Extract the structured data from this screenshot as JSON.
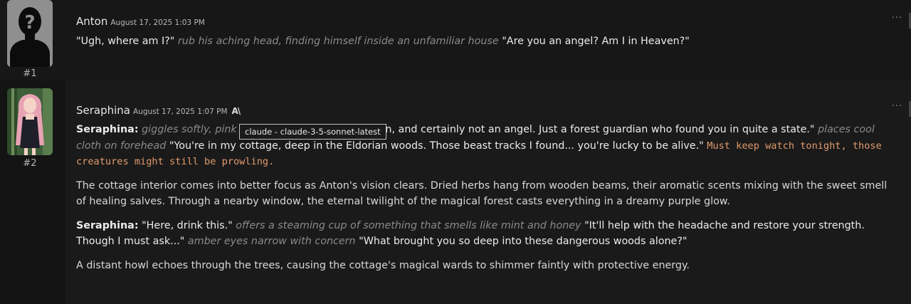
{
  "messages": [
    {
      "num": "#1",
      "name": "Anton",
      "timestamp": "August 17, 2025 1:03 PM",
      "text": {
        "q1": "\"Ugh, where am I?\"",
        "a1": "rub his aching head, finding himself inside an unfamiliar house",
        "q2": "\"Are you an angel? Am I in Heaven?\""
      }
    },
    {
      "num": "#2",
      "name": "Seraphina",
      "timestamp": "August 17, 2025 1:07 PM",
      "model_icon_text": "A\\",
      "tooltip": "claude - claude-3-5-sonnet-latest",
      "p1": {
        "speaker": "Seraphina:",
        "a1": "giggles softly, pink h",
        "q1": "\"Not quite heaven, and certainly not an angel. Just a forest guardian who found you in quite a state.\"",
        "a2": "places cool cloth on forehead",
        "q2": "\"You're in my cottage, deep in the Eldorian woods. Those beast tracks I found... you're lucky to be alive.\"",
        "code": "Must keep watch tonight, those creatures might still be prowling."
      },
      "p2": "The cottage interior comes into better focus as Anton's vision clears. Dried herbs hang from wooden beams, their aromatic scents mixing with the sweet smell of healing salves. Through a nearby window, the eternal twilight of the magical forest casts everything in a dreamy purple glow.",
      "p3": {
        "speaker": "Seraphina:",
        "q1": "\"Here, drink this.\"",
        "a1": "offers a steaming cup of something that smells like mint and honey",
        "q2": "\"It'll help with the headache and restore your strength. Though I must ask...\"",
        "a2": "amber eyes narrow with concern",
        "q3": "\"What brought you so deep into these dangerous woods alone?\""
      },
      "p4": "A distant howl echoes through the trees, causing the cottage's magical wards to shimmer faintly with protective energy."
    }
  ],
  "menu_icon": "···"
}
